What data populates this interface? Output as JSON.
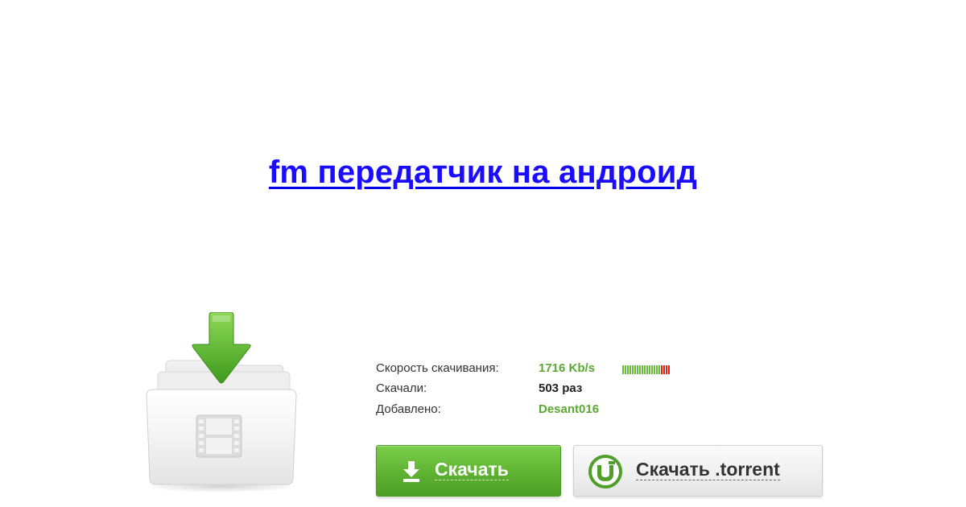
{
  "title": {
    "text": "fm передатчик на андроид"
  },
  "stats": {
    "speed_label": "Скорость скачивания:",
    "speed_value": "1716 Kb/s",
    "downloads_label": "Скачали:",
    "downloads_value": "503 раз",
    "added_label": "Добавлено:",
    "added_value": "Desant016"
  },
  "speed_meter": {
    "green_bars": 16,
    "red_bars": 4,
    "green_color": "#6cbb3c",
    "red_color": "#d9231b"
  },
  "buttons": {
    "download_label": "Скачать",
    "torrent_label": "Скачать .torrent"
  },
  "colors": {
    "title_link": "#1a0dff",
    "accent_green": "#5db231",
    "value_green": "#5aa832"
  },
  "icons": {
    "folder": "video-folder-download-icon",
    "download": "download-arrow-icon",
    "torrent": "utorrent-icon"
  }
}
